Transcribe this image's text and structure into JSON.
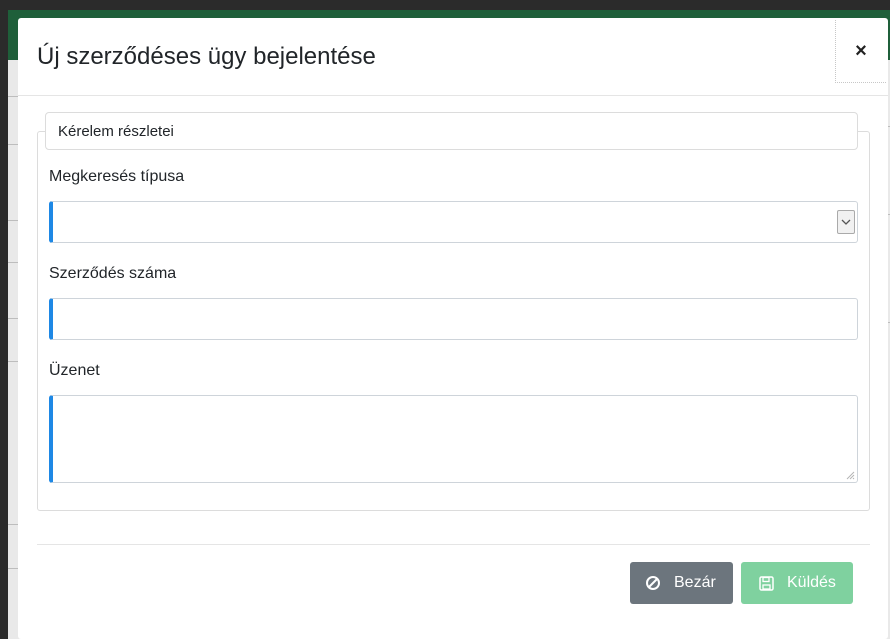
{
  "dialog": {
    "title": "Új szerződéses ügy bejelentése",
    "close_glyph": "×"
  },
  "form": {
    "legend": "Kérelem részletei",
    "fields": {
      "request_type": {
        "label": "Megkeresés típusa",
        "value": ""
      },
      "contract_number": {
        "label": "Szerződés száma",
        "value": ""
      },
      "message": {
        "label": "Üzenet",
        "value": ""
      }
    }
  },
  "footer": {
    "close_button": {
      "label": "Bezár",
      "icon": "ban-icon",
      "color": "#6c757d"
    },
    "send_button": {
      "label": "Küldés",
      "icon": "floppy-disk-icon",
      "color": "#7fd19f"
    }
  },
  "colors": {
    "field_accent": "#1e88e5",
    "header_bar": "#1f5f3a"
  }
}
